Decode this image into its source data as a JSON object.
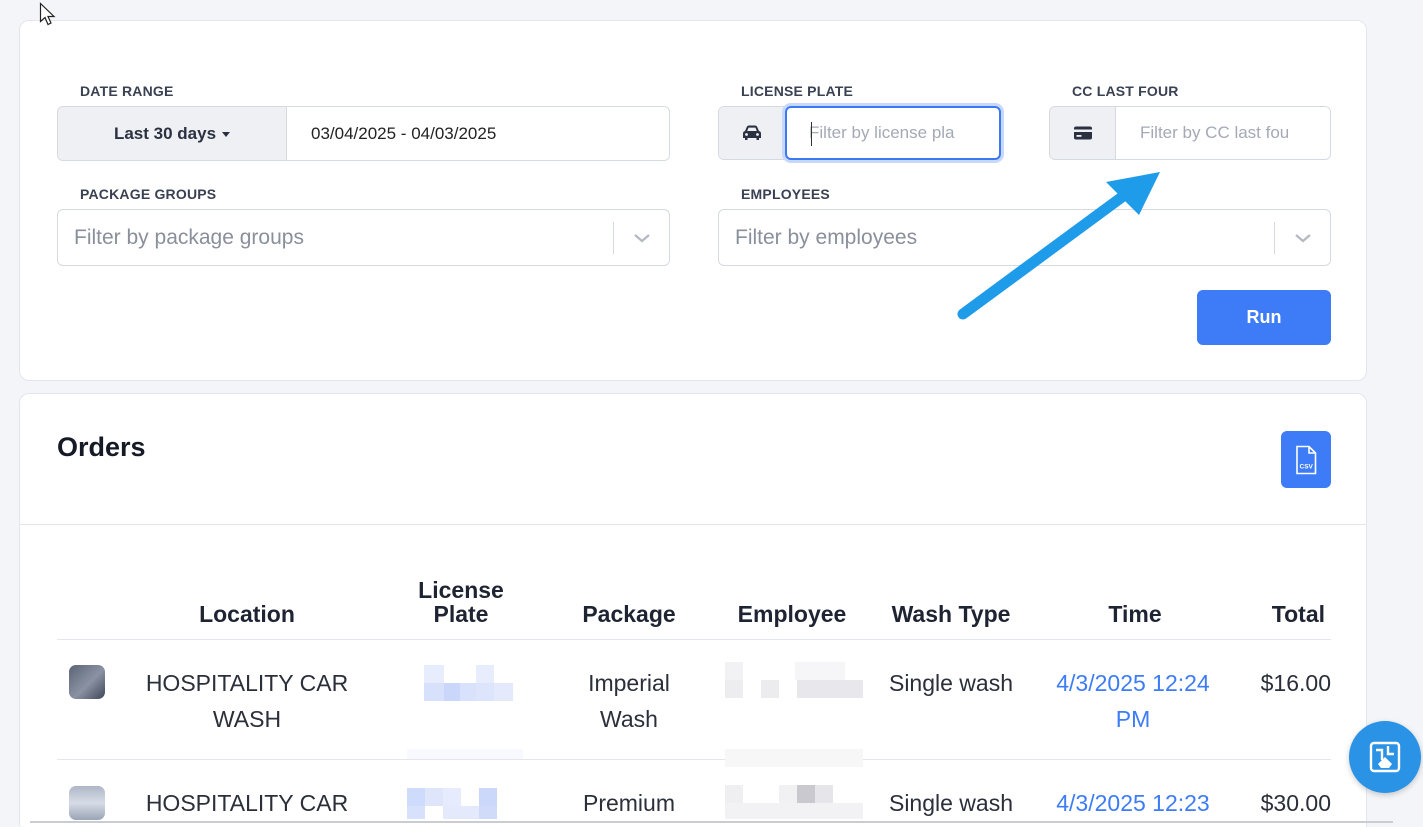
{
  "filters": {
    "date_range": {
      "label": "DATE RANGE",
      "preset": "Last 30 days",
      "value": "03/04/2025 - 04/03/2025"
    },
    "license_plate": {
      "label": "LICENSE PLATE",
      "placeholder": "Filter by license pla",
      "icon": "car-icon"
    },
    "cc_last_four": {
      "label": "CC LAST FOUR",
      "placeholder": "Filter by CC last fou",
      "icon": "credit-card-icon"
    },
    "package_groups": {
      "label": "PACKAGE GROUPS",
      "placeholder": "Filter by package groups"
    },
    "employees": {
      "label": "EMPLOYEES",
      "placeholder": "Filter by employees"
    },
    "run_label": "Run"
  },
  "orders": {
    "title": "Orders",
    "export_icon": "csv-file-icon",
    "export_icon_text": "CSV",
    "columns": {
      "location": "Location",
      "license_plate_line1": "License",
      "license_plate_line2": "Plate",
      "package": "Package",
      "employee": "Employee",
      "wash_type": "Wash Type",
      "time": "Time",
      "total": "Total"
    },
    "rows": [
      {
        "location_line1": "HOSPITALITY CAR",
        "location_line2": "WASH",
        "package_line1": "Imperial",
        "package_line2": "Wash",
        "wash_type": "Single wash",
        "time_line1": "4/3/2025 12:24",
        "time_line2": "PM",
        "total": "$16.00"
      },
      {
        "location_line1": "HOSPITALITY CAR",
        "package_line1": "Premium",
        "wash_type": "Single wash",
        "time_line1": "4/3/2025 12:23",
        "total": "$30.00"
      }
    ]
  },
  "colors": {
    "accent": "#3d7cf6",
    "annotation_arrow": "#1e9be9",
    "help_bubble": "#2a93e5"
  }
}
